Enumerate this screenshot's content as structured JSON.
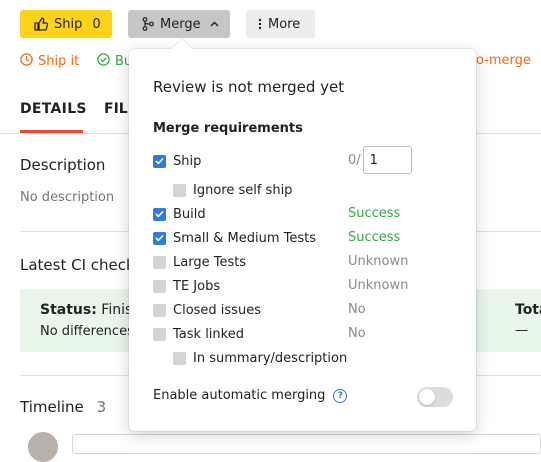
{
  "toolbar": {
    "ship_label": "Ship",
    "ship_count": "0",
    "merge_label": "Merge",
    "more_label": "More"
  },
  "strip": {
    "ship_it": "Ship it",
    "build_partial": "Bu",
    "auto_merge_partial": "o-merge"
  },
  "tabs": {
    "details": "DETAILS",
    "files_partial": "FIL"
  },
  "description": {
    "title": "Description",
    "text": "No description"
  },
  "ci": {
    "title_partial": "Latest CI check",
    "status_label": "Status:",
    "status_partial": "Finis",
    "diff_partial": "No differences",
    "total_partial": "Tota",
    "total_value": "—"
  },
  "timeline": {
    "title": "Timeline",
    "count": "3"
  },
  "popup": {
    "title": "Review is not merged yet",
    "requirements_title": "Merge requirements",
    "ship": {
      "label": "Ship",
      "checked": true,
      "counter_prefix": "0/",
      "required_value": "1"
    },
    "ignore_self_ship": {
      "label": "Ignore self ship",
      "checked": false
    },
    "build": {
      "label": "Build",
      "checked": true,
      "status": "Success"
    },
    "tests": {
      "label": "Small & Medium Tests",
      "checked": true,
      "status": "Success"
    },
    "large_tests": {
      "label": "Large Tests",
      "checked": false,
      "status": "Unknown"
    },
    "te_jobs": {
      "label": "TE Jobs",
      "checked": false,
      "status": "Unknown"
    },
    "closed_issues": {
      "label": "Closed issues",
      "checked": false,
      "status": "No"
    },
    "task_linked": {
      "label": "Task linked",
      "checked": false,
      "status": "No"
    },
    "in_summary": {
      "label": "In summary/description",
      "checked": false
    },
    "auto_merge_label": "Enable automatic merging",
    "auto_merge_enabled": false
  },
  "colors": {
    "ship_yellow": "#ffd31a",
    "accent_orange": "#f06a13",
    "success_green": "#35a845",
    "checkbox_blue": "#2f7bdc",
    "tab_red": "#e84b3c"
  },
  "icons": {
    "ship": "thumbs-up-icon",
    "merge": "merge-icon",
    "more": "kebab-icon",
    "ship_it": "clock-icon",
    "build": "check-circle-icon",
    "help": "question-icon"
  }
}
